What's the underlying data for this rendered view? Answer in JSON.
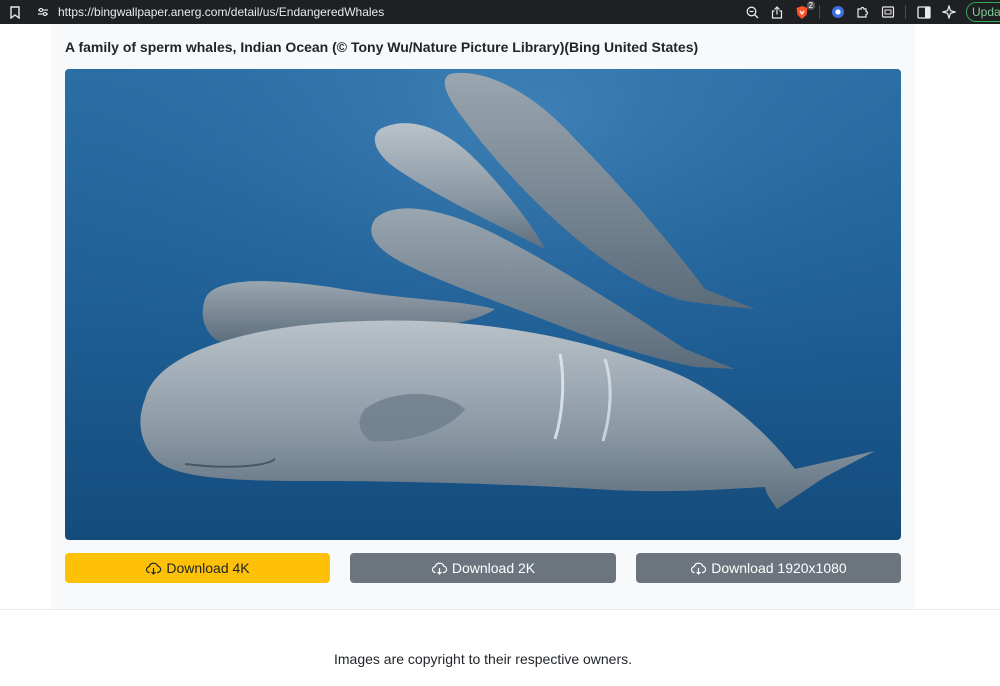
{
  "browser": {
    "url": "https://bingwallpaper.anerg.com/detail/us/EndangeredWhales",
    "brave_badge_count": "2",
    "update_label": "Upda",
    "icons": [
      "bookmark-icon",
      "site-settings-icon",
      "zoom-icon",
      "share-icon",
      "brave-shields-icon",
      "extension-blue-icon",
      "extensions-puzzle-icon",
      "screenshot-icon",
      "sidebar-icon",
      "leo-ai-icon"
    ]
  },
  "page": {
    "title": "A family of sperm whales, Indian Ocean (© Tony Wu/Nature Picture Library)(Bing United States)",
    "buttons": {
      "download_4k": "Download 4K",
      "download_2k": "Download 2K",
      "download_1080": "Download 1920x1080"
    },
    "footer": "Images are copyright to their respective owners."
  },
  "colors": {
    "primary_button": "#ffc107",
    "secondary_button": "#6c757d",
    "chrome_bg": "#1f2023",
    "ocean": "#1f5f92"
  }
}
